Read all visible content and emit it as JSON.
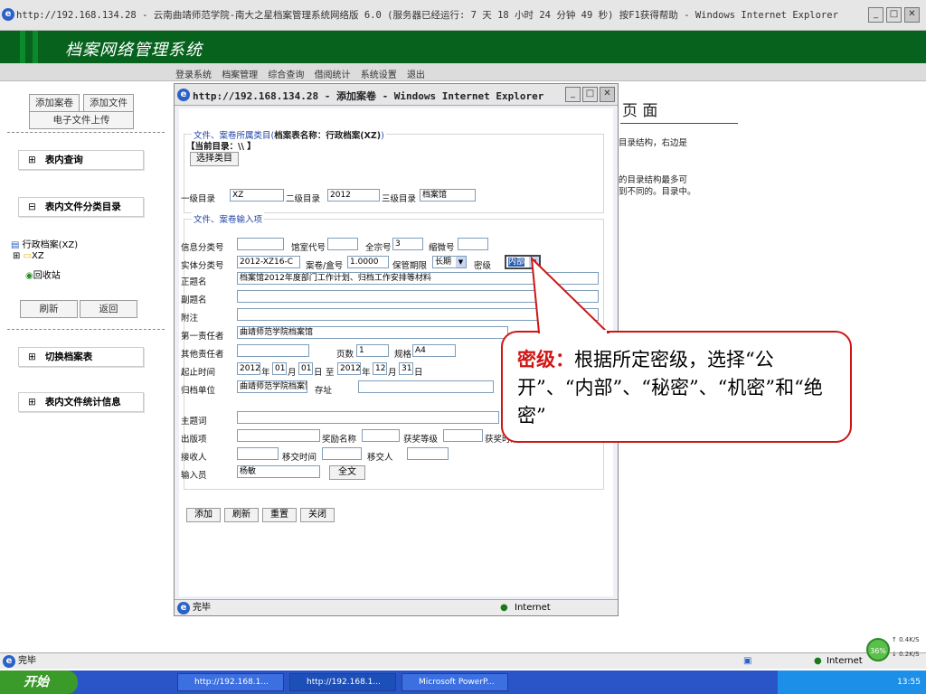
{
  "window": {
    "title": "http://192.168.134.28 - 云南曲靖师范学院-南大之星档案管理系统网络版 6.0 (服务器已经运行: 7 天 18 小时 24 分钟 49 秒) 按F1获得帮助 - Windows Internet Explorer"
  },
  "banner": {
    "title": "档案网络管理系统"
  },
  "menu": [
    "登录系统",
    "档案管理",
    "综合查询",
    "借阅统计",
    "系统设置",
    "退出"
  ],
  "sidebar": {
    "add_volume": "添加案卷",
    "add_file": "添加文件",
    "upload": "电子文件上传",
    "sections": {
      "query": "表内查询",
      "catalog": "表内文件分类目录",
      "switch": "切换档案表",
      "stats": "表内文件统计信息"
    },
    "tree": {
      "root": "行政档案(XZ)",
      "child": "XZ",
      "recycle": "回收站"
    },
    "refresh": "刷新",
    "back": "返回"
  },
  "background_page": {
    "heading": "页 面",
    "lines": [
      "目录结构，右边是",
      "的目录结构最多可",
      "到不同的。目录中。"
    ]
  },
  "popup": {
    "title": "http://192.168.134.28 - 添加案卷 - Windows Internet Explorer",
    "category_legend": "文件、案卷所属类目(",
    "table_name": "档案表名称：行政档案(XZ)",
    "category_legend_end": ")",
    "current_dir_label": "【当前目录：\\\\ 】",
    "select_category": "选择类目",
    "level1_label": "一级目录",
    "level1_value": "XZ",
    "level2_label": "二级目录",
    "level2_value": "2012",
    "level3_label": "三级目录",
    "level3_value": "档案馆",
    "input_legend": "文件、案卷输入项",
    "fields": {
      "info_class": "信息分类号",
      "room_code": "馆室代号",
      "fonds_label": "全宗号",
      "fonds_value": "3",
      "microfilm": "缩微号",
      "entity_label": "实体分类号",
      "entity_value": "2012-XZ16-C",
      "box_label": "案卷/盒号",
      "box_value": "1.0000",
      "retention_label": "保管期限",
      "retention_value": "长期",
      "secrecy_label": "密级",
      "secrecy_value": "内部",
      "title_label": "正题名",
      "title_value": "档案馆2012年度部门工作计划、归档工作安排等材料",
      "subtitle_label": "副题名",
      "note_label": "附注",
      "first_resp_label": "第一责任者",
      "first_resp_value": "曲靖师范学院档案馆",
      "other_resp_label": "其他责任者",
      "pages_label": "页数",
      "pages_value": "1",
      "spec_label": "规格",
      "spec_value": "A4",
      "period_label": "起止时间",
      "start_year": "2012",
      "year_unit": "年",
      "start_month": "01",
      "month_unit": "月",
      "start_day": "01",
      "day_unit": "日",
      "to_label": "至",
      "end_year": "2012",
      "end_month": "12",
      "end_day": "31",
      "archive_unit_label": "归档单位",
      "archive_unit_value": "曲靖师范学院档案馆",
      "storage_label": "存址",
      "subject_label": "主题词",
      "publish_label": "出版项",
      "award_name_label": "奖励名称",
      "award_level_label": "获奖等级",
      "award_time_label": "获奖时间",
      "receiver_label": "接收人",
      "transfer_time_label": "移交时间",
      "transferer_label": "移交人",
      "operator_label": "输入员",
      "operator_value": "杨敏",
      "fulltext_button": "全文"
    },
    "buttons": {
      "add": "添加",
      "refresh": "刷新",
      "reset": "重置",
      "close": "关闭"
    },
    "status": {
      "done": "完毕",
      "zone": "Internet"
    }
  },
  "callout": {
    "highlight": "密级：",
    "text": "根据所定密级，选择“公开”、“内部”、“秘密”、“机密”和“绝密”"
  },
  "main_status": {
    "done": "完毕",
    "zone": "Internet",
    "percent": "36%",
    "up": "0.4K/S",
    "down": "0.2K/S"
  },
  "taskbar": {
    "start": "开始",
    "tasks": [
      "http://192.168.1...",
      "http://192.168.1...",
      "Microsoft PowerP..."
    ],
    "time": "13:55"
  }
}
